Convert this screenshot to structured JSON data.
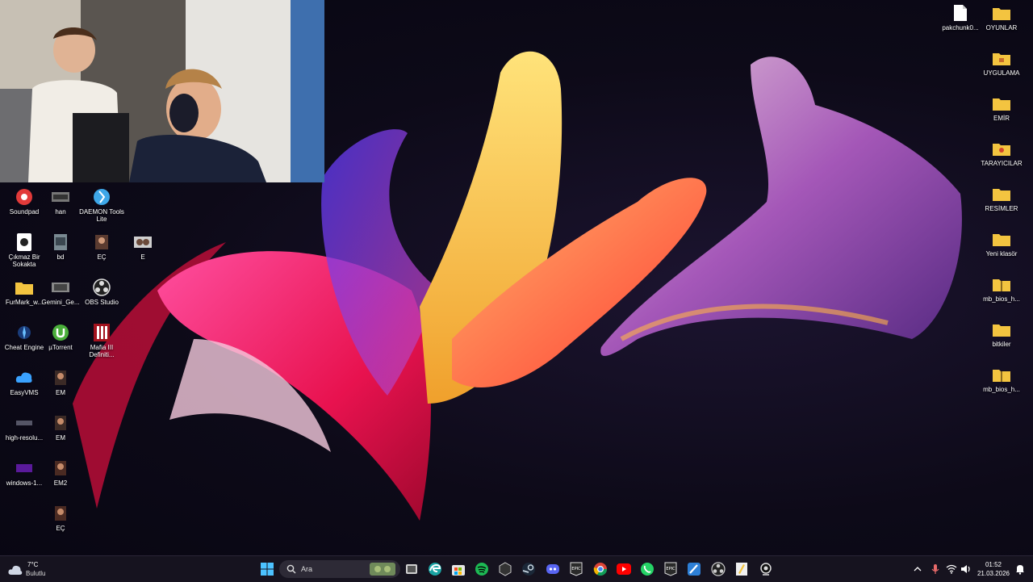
{
  "desktop_left": [
    {
      "label": "Soundpad",
      "icon": "soundpad-icon"
    },
    {
      "label": "han",
      "icon": "image-file-icon"
    },
    {
      "label": "DAEMON Tools Lite",
      "icon": "daemon-tools-icon"
    },
    {
      "label": "Çıkmaz Bir Sokakta",
      "icon": "video-file-icon"
    },
    {
      "label": "bd",
      "icon": "image-file-icon"
    },
    {
      "label": "EÇ",
      "icon": "image-file-icon"
    },
    {
      "label": "E",
      "icon": "image-file-icon"
    },
    {
      "label": "FurMark_w...",
      "icon": "folder-icon"
    },
    {
      "label": "Gemini_Ge...",
      "icon": "image-file-icon"
    },
    {
      "label": "OBS Studio",
      "icon": "obs-icon"
    },
    {
      "label": "Cheat Engine",
      "icon": "cheat-engine-icon"
    },
    {
      "label": "µTorrent",
      "icon": "utorrent-icon"
    },
    {
      "label": "Mafia III Definiti...",
      "icon": "mafia-icon"
    },
    {
      "label": "EasyVMS",
      "icon": "easyvms-icon"
    },
    {
      "label": "EM",
      "icon": "image-file-icon"
    },
    {
      "label": "high-resolu...",
      "icon": "image-file-icon"
    },
    {
      "label": "EM",
      "icon": "image-file-icon"
    },
    {
      "label": "windows-1...",
      "icon": "image-file-icon"
    },
    {
      "label": "EM2",
      "icon": "image-file-icon"
    },
    {
      "label": "EÇ",
      "icon": "image-file-icon"
    }
  ],
  "desktop_right": [
    {
      "label": "pakchunk0...",
      "icon": "file-icon"
    },
    {
      "label": "OYUNLAR",
      "icon": "folder-icon"
    },
    {
      "label": "UYGULAMA",
      "icon": "folder-icon"
    },
    {
      "label": "EMİR",
      "icon": "folder-icon"
    },
    {
      "label": "TARAYICILAR",
      "icon": "folder-icon"
    },
    {
      "label": "RESİMLER",
      "icon": "folder-icon"
    },
    {
      "label": "Yeni klasör",
      "icon": "folder-icon"
    },
    {
      "label": "mb_bios_h...",
      "icon": "zip-folder-icon"
    },
    {
      "label": "bitkiler",
      "icon": "folder-icon"
    },
    {
      "label": "mb_bios_h...",
      "icon": "zip-folder-icon"
    }
  ],
  "taskbar": {
    "weather_temp": "7°C",
    "weather_desc": "Bulutlu",
    "search_placeholder": "Ara",
    "time": "01:52",
    "date": "21.03.2026"
  },
  "colors": {
    "taskbar_bg": "#16131f",
    "folder": "#f3c440",
    "accent": "#3b8ddb"
  }
}
